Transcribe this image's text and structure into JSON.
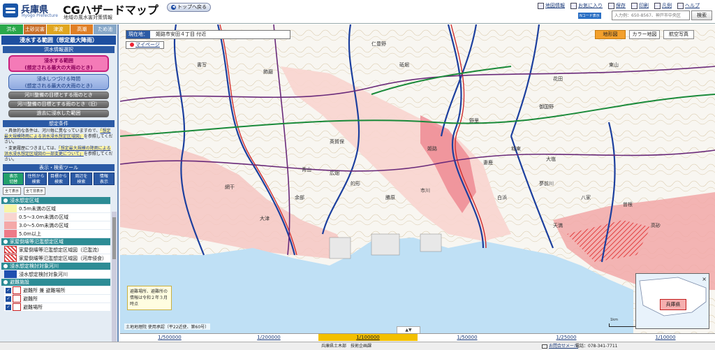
{
  "header": {
    "pref_name": "兵庫県",
    "pref_name_en": "Hyogo Prefecture",
    "app_title": "CGハザードマップ",
    "app_subtitle": "地域の風水害対策情報",
    "top_button": "トップへ戻る",
    "links": [
      {
        "label": "地図情報",
        "icon": "map-info-icon"
      },
      {
        "label": "お気に入り",
        "icon": "favorite-icon"
      },
      {
        "label": "保存",
        "icon": "save-icon"
      },
      {
        "label": "印刷",
        "icon": "print-icon"
      },
      {
        "label": "凡例",
        "icon": "legend-icon"
      },
      {
        "label": "ヘルプ",
        "icon": "help-icon"
      }
    ],
    "ncode_label": "Nコード表示",
    "address_placeholder": "入力例：650-8567、神戸市中央区",
    "search_label": "検索"
  },
  "sidebar": {
    "disaster_tabs": [
      {
        "label": "洪水",
        "color": "#2aa84a",
        "text": "#ffffff"
      },
      {
        "label": "土砂災害",
        "color": "#c8702a",
        "text": "#ffffff"
      },
      {
        "label": "津波",
        "color": "#e0a620",
        "text": "#ffffff"
      },
      {
        "label": "高潮",
        "color": "#e07f26",
        "text": "#ffffff"
      },
      {
        "label": "ため池",
        "color": "#88a8c8",
        "text": "#ffffff"
      }
    ],
    "section_title": "浸水する範囲（想定最大降雨）",
    "info_select_title": "洪水情報選択",
    "btn_range": {
      "line1": "浸水する範囲",
      "line2": "(想定される最大の大雨のとき)"
    },
    "btn_duration": {
      "line1": "浸水しつづける時間",
      "line2": "(想定される最大の大雨のとき)"
    },
    "gray_buttons": [
      "河川整備の目標とする雨のとき",
      "河川整備の目標とする雨のとき（旧）",
      "過去に浸水した範囲"
    ],
    "conditions_title": "想定条件",
    "conditions_text1": "・具体的な条件は、河川毎に異なっていますので、",
    "conditions_link1": "「想定最大規模降雨による洪水浸水想定区域図」",
    "conditions_text1b": "を参照してください。",
    "conditions_text2": "・変更履歴につきましては、",
    "conditions_link2": "「想定最大規模の降雨による洪水浸水想定区域図の一部変更について」",
    "conditions_text2b": "を参照してください。",
    "tools_title": "表示・検索ツール",
    "tools": [
      {
        "line1": "表示",
        "line2": "切替",
        "active": true
      },
      {
        "line1": "住所から",
        "line2": "検索",
        "active": false
      },
      {
        "line1": "目標から",
        "line2": "検索",
        "active": false
      },
      {
        "line1": "周辺を",
        "line2": "検索",
        "active": false
      },
      {
        "line1": "情報",
        "line2": "表示",
        "active": false
      }
    ],
    "hide_all": "全て表示",
    "show_all": "全て非表示",
    "legend": [
      {
        "type": "header",
        "label": "浸水想定区域"
      },
      {
        "type": "item",
        "label": "0.5m未満の区域",
        "color": "#f7f5a8"
      },
      {
        "type": "item",
        "label": "0.5〜3.0m未満の区域",
        "color": "#f9d5d0"
      },
      {
        "type": "item",
        "label": "3.0〜5.0m未満の区域",
        "color": "#f4a8a8"
      },
      {
        "type": "item",
        "label": "5.0m以上",
        "color": "#ee7a88"
      },
      {
        "type": "header",
        "label": "家屋倒壊等氾濫想定区域"
      },
      {
        "type": "hatch",
        "label": "家屋倒壊等氾濫想定区域図（氾濫流）"
      },
      {
        "type": "hatch",
        "label": "家屋倒壊等氾濫想定区域図（河岸侵食）"
      },
      {
        "type": "header",
        "label": "浸水想定検討対象河川"
      },
      {
        "type": "item",
        "label": "浸水想定検討対象河川",
        "color": "#1f4fb0"
      },
      {
        "type": "header",
        "label": "避難施設"
      },
      {
        "type": "check",
        "label": "避難所 兼 避難場所",
        "icon": "shelter-icon"
      },
      {
        "type": "check",
        "label": "避難所",
        "icon": "evac-center-icon"
      },
      {
        "type": "check",
        "label": "避難場所",
        "icon": "evac-site-icon"
      }
    ],
    "guide_link": "CGガイドについて"
  },
  "map": {
    "location_label": "現在地：",
    "location_value": "姫路市安田４丁目 付近",
    "mypage_label": "マイページ",
    "map_types": [
      {
        "label": "地形図",
        "active": true
      },
      {
        "label": "カラー地図",
        "active": false
      },
      {
        "label": "航空写真",
        "active": false
      }
    ],
    "shelter_note": "避難場所、避難所の情報は令和２年３月時点",
    "attribution": "土地地理院 使用承認（平22近使、第60号）",
    "scale_label": "1km",
    "overview_label": "兵庫県",
    "toggle_tab": "▲▼",
    "place_labels": [
      "飾磨",
      "姫路",
      "広畑",
      "網干",
      "大塩",
      "八家",
      "白浜",
      "英賀保",
      "青山",
      "余部",
      "書写",
      "仁豊野",
      "砥堀",
      "野里",
      "御国野",
      "花田",
      "城東",
      "東山",
      "夢前川",
      "市川",
      "大津",
      "勝原",
      "妻鹿",
      "天満",
      "的形",
      "曽根",
      "高砂"
    ],
    "colors": {
      "sea": "#bfe0f5",
      "river": "#1c3f9e",
      "flood_light": "#f8d5cf",
      "flood_mid": "#f2a8a8",
      "flood_deep": "#ec7b86",
      "rail": "#1a8a3a",
      "road_major": "#c04080"
    }
  },
  "scales": [
    {
      "label": "1/500000",
      "active": false
    },
    {
      "label": "1/200000",
      "active": false
    },
    {
      "label": "1/100000",
      "active": true
    },
    {
      "label": "1/50000",
      "active": false
    },
    {
      "label": "1/25000",
      "active": false
    },
    {
      "label": "1/10000",
      "active": false
    }
  ],
  "footer": {
    "organization": "兵庫県土木部　技術企画課",
    "contact": "お問合せメール",
    "tel": "電話：078-341-7711"
  }
}
